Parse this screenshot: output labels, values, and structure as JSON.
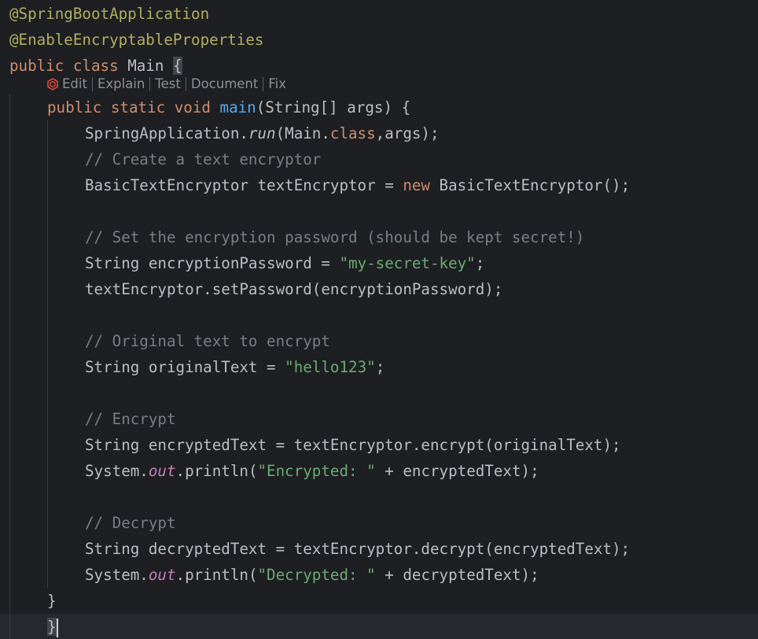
{
  "code": {
    "line_annotation_1": "@SpringBootApplication",
    "line_annotation_2": "@EnableEncryptableProperties",
    "class_kw_public": "public",
    "class_kw_class": "class",
    "class_name": "Main",
    "open_brace": "{",
    "main_kw_public": "public",
    "main_kw_static": "static",
    "main_kw_void": "void",
    "main_name": "main",
    "main_params": "(String[] args) {",
    "run_obj": "SpringApplication.",
    "run_method": "run",
    "run_args_start": "(Main.",
    "run_class_kw": "class",
    "run_args_end": ",args);",
    "comment_create": "// Create a text encryptor",
    "encryptor_decl_start": "BasicTextEncryptor textEncryptor = ",
    "encryptor_new_kw": "new",
    "encryptor_decl_end": " BasicTextEncryptor();",
    "comment_password": "// Set the encryption password (should be kept secret!)",
    "password_decl_start": "String encryptionPassword = ",
    "password_value": "\"my-secret-key\"",
    "password_decl_end": ";",
    "set_password": "textEncryptor.setPassword(encryptionPassword);",
    "comment_original": "// Original text to encrypt",
    "original_decl_start": "String originalText = ",
    "original_value": "\"hello123\"",
    "original_decl_end": ";",
    "comment_encrypt": "// Encrypt",
    "encrypt_call": "String encryptedText = textEncryptor.encrypt(originalText);",
    "print1_obj": "System.",
    "print1_field": "out",
    "print1_mid": ".println(",
    "print1_str": "\"Encrypted: \"",
    "print1_end": " + encryptedText);",
    "comment_decrypt": "// Decrypt",
    "decrypt_call": "String decryptedText = textEncryptor.decrypt(encryptedText);",
    "print2_obj": "System.",
    "print2_field": "out",
    "print2_mid": ".println(",
    "print2_str": "\"Decrypted: \"",
    "print2_end": " + decryptedText);",
    "close_method": "}",
    "close_class": "}"
  },
  "codevision": {
    "icon": "ai-assistant-icon",
    "items": [
      "Edit",
      "Explain",
      "Test",
      "Document",
      "Fix"
    ]
  },
  "colors": {
    "background": "#1e1f22",
    "current_line": "#26282e",
    "text": "#bcbec4",
    "keyword": "#cf8e6d",
    "annotation": "#b3ae60",
    "function": "#56a8f5",
    "string": "#6aab73",
    "comment": "#7a7e85",
    "static_field": "#c77dbb",
    "ai_icon": "#e0493f"
  }
}
